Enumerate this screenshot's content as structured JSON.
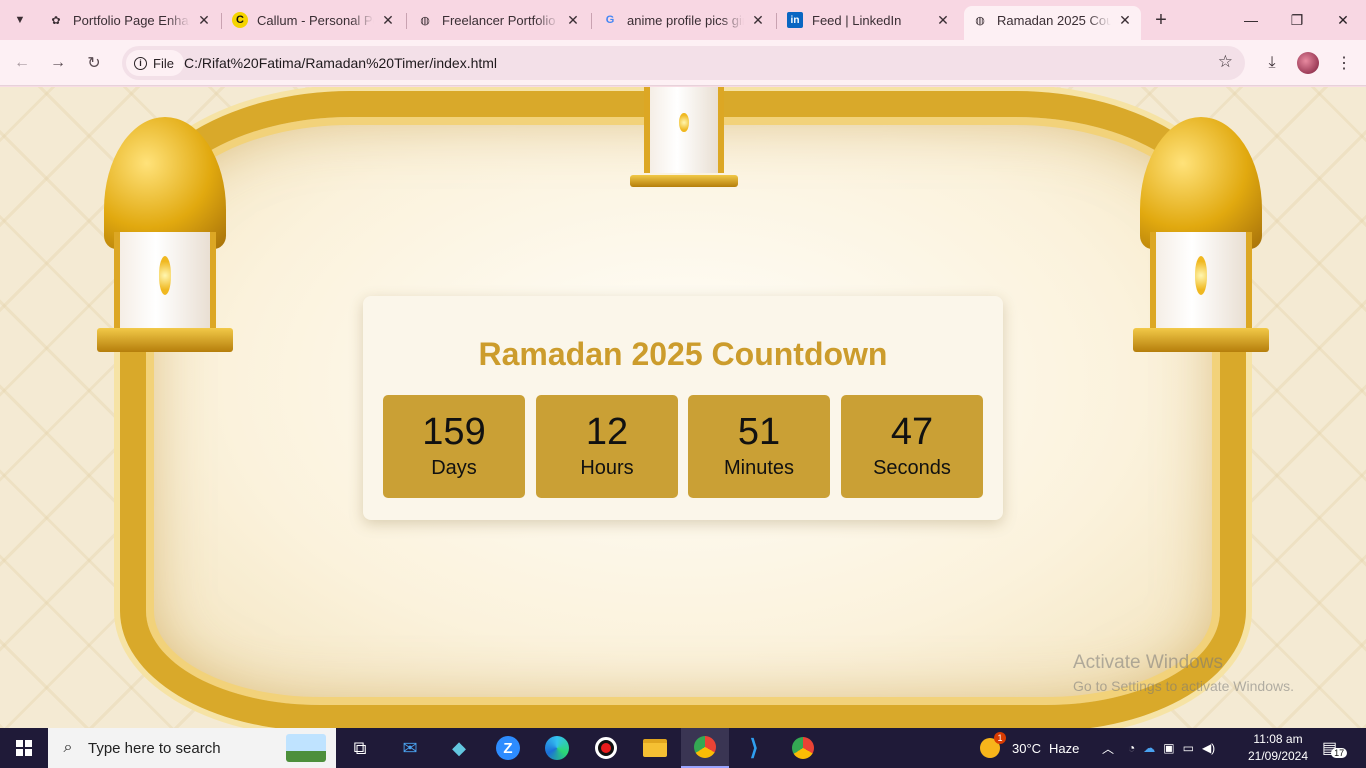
{
  "browser": {
    "tabs": [
      {
        "title": "Portfolio Page Enhancement",
        "favicon": "openai-icon",
        "active": false
      },
      {
        "title": "Callum - Personal Portfolio",
        "favicon": "c-logo-icon",
        "active": false
      },
      {
        "title": "Freelancer Portfolio",
        "favicon": "globe-icon",
        "active": false
      },
      {
        "title": "anime profile pics girl",
        "favicon": "google-icon",
        "active": false
      },
      {
        "title": "Feed | LinkedIn",
        "favicon": "linkedin-icon",
        "active": false
      },
      {
        "title": "Ramadan 2025 Countdown",
        "favicon": "globe-icon",
        "active": true
      }
    ],
    "address": {
      "chip_label": "File",
      "url": "C:/Rifat%20Fatima/Ramadan%20Timer/index.html"
    }
  },
  "page": {
    "title": "Ramadan 2025 Countdown",
    "countdown": [
      {
        "value": "159",
        "label": "Days"
      },
      {
        "value": "12",
        "label": "Hours"
      },
      {
        "value": "51",
        "label": "Minutes"
      },
      {
        "value": "47",
        "label": "Seconds"
      }
    ],
    "watermark": {
      "line1": "Activate Windows",
      "line2": "Go to Settings to activate Windows."
    },
    "colors": {
      "accent": "#cc9c2c",
      "tile": "#caa035"
    }
  },
  "taskbar": {
    "search_placeholder": "Type here to search",
    "weather": {
      "badge": "1",
      "temp": "30°C",
      "condition": "Haze"
    },
    "clock": {
      "time": "11:08 am",
      "date": "21/09/2024"
    },
    "notifications": "17"
  }
}
